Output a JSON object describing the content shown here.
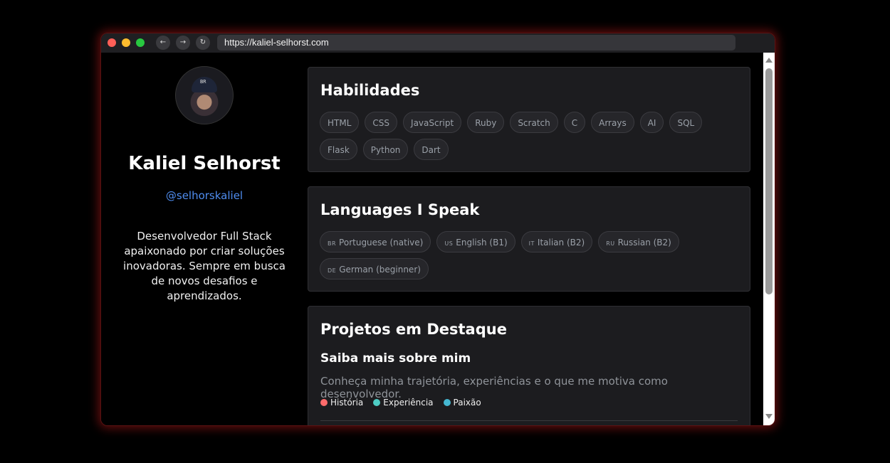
{
  "browser": {
    "url": "https://kaliel-selhorst.com",
    "back_icon": "←",
    "forward_icon": "→",
    "reload_icon": "↻"
  },
  "profile": {
    "avatar_cap_text": "BR",
    "name": "Kaliel Selhorst",
    "handle": "@selhorskaliel",
    "bio": "Desenvolvedor Full Stack apaixonado por criar soluções inovadoras. Sempre em busca de novos desafios e aprendizados."
  },
  "skills": {
    "title": "Habilidades",
    "items": [
      "HTML",
      "CSS",
      "JavaScript",
      "Ruby",
      "Scratch",
      "C",
      "Arrays",
      "AI",
      "SQL",
      "Flask",
      "Python",
      "Dart"
    ]
  },
  "languages": {
    "title": "Languages I Speak",
    "items": [
      {
        "flag": "BR",
        "label": "Portuguese (native)"
      },
      {
        "flag": "US",
        "label": "English (B1)"
      },
      {
        "flag": "IT",
        "label": "Italian (B2)"
      },
      {
        "flag": "RU",
        "label": "Russian (B2)"
      },
      {
        "flag": "DE",
        "label": "German (beginner)"
      }
    ]
  },
  "projects": {
    "title": "Projetos em Destaque",
    "featured": {
      "title": "Saiba mais sobre mim",
      "description": "Conheça minha trajetória, experiências e o que me motiva como desenvolvedor.",
      "tags": [
        {
          "label": "História",
          "color": "#ff6b6b"
        },
        {
          "label": "Experiência",
          "color": "#4ecdc4"
        },
        {
          "label": "Paixão",
          "color": "#45b7d1"
        }
      ]
    }
  },
  "colors": {
    "link": "#4f8df0",
    "glow": "#dc1e1e"
  }
}
